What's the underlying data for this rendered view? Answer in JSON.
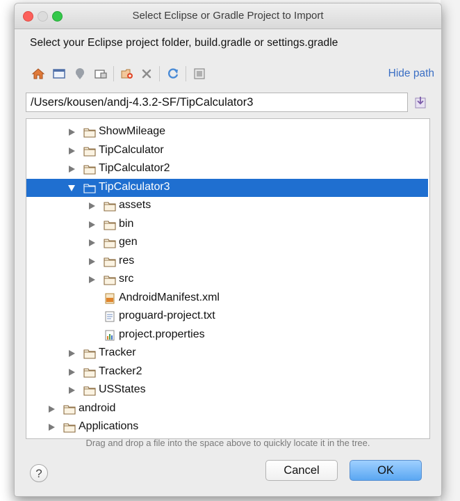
{
  "window": {
    "title": "Select Eclipse or Gradle Project to Import"
  },
  "instruction": "Select your Eclipse project folder, build.gradle or settings.gradle",
  "toolbar": {
    "icons": [
      "home-icon",
      "desktop-icon",
      "user-home-icon",
      "project-folder-icon",
      "new-folder-icon",
      "delete-icon",
      "refresh-icon",
      "show-hidden-icon"
    ],
    "hide_path_label": "Hide path"
  },
  "path": {
    "value": "/Users/kousen/andj-4.3.2-SF/TipCalculator3"
  },
  "tree": {
    "rows": [
      {
        "label": "ShowMileage",
        "depth": 2,
        "type": "folder",
        "expanded": false,
        "selected": false
      },
      {
        "label": "TipCalculator",
        "depth": 2,
        "type": "folder",
        "expanded": false,
        "selected": false
      },
      {
        "label": "TipCalculator2",
        "depth": 2,
        "type": "folder",
        "expanded": false,
        "selected": false
      },
      {
        "label": "TipCalculator3",
        "depth": 2,
        "type": "folder",
        "expanded": true,
        "selected": true
      },
      {
        "label": "assets",
        "depth": 3,
        "type": "folder",
        "expanded": false,
        "selected": false
      },
      {
        "label": "bin",
        "depth": 3,
        "type": "folder",
        "expanded": false,
        "selected": false
      },
      {
        "label": "gen",
        "depth": 3,
        "type": "folder",
        "expanded": false,
        "selected": false
      },
      {
        "label": "res",
        "depth": 3,
        "type": "folder",
        "expanded": false,
        "selected": false
      },
      {
        "label": "src",
        "depth": 3,
        "type": "folder",
        "expanded": false,
        "selected": false
      },
      {
        "label": "AndroidManifest.xml",
        "depth": 3,
        "type": "xml-file",
        "selected": false
      },
      {
        "label": "proguard-project.txt",
        "depth": 3,
        "type": "text-file",
        "selected": false
      },
      {
        "label": "project.properties",
        "depth": 3,
        "type": "properties-file",
        "selected": false
      },
      {
        "label": "Tracker",
        "depth": 2,
        "type": "folder",
        "expanded": false,
        "selected": false
      },
      {
        "label": "Tracker2",
        "depth": 2,
        "type": "folder",
        "expanded": false,
        "selected": false
      },
      {
        "label": "USStates",
        "depth": 2,
        "type": "folder",
        "expanded": false,
        "selected": false
      },
      {
        "label": "android",
        "depth": 1,
        "type": "folder",
        "expanded": false,
        "selected": false
      },
      {
        "label": "Applications",
        "depth": 1,
        "type": "folder",
        "expanded": false,
        "selected": false
      }
    ]
  },
  "hint": "Drag and drop a file into the space above to quickly locate it in the tree.",
  "buttons": {
    "help": "?",
    "cancel": "Cancel",
    "ok": "OK"
  },
  "colors": {
    "selection": "#1f6fd0",
    "link": "#3b6fc4",
    "ok_button": "#5aa7f2"
  }
}
